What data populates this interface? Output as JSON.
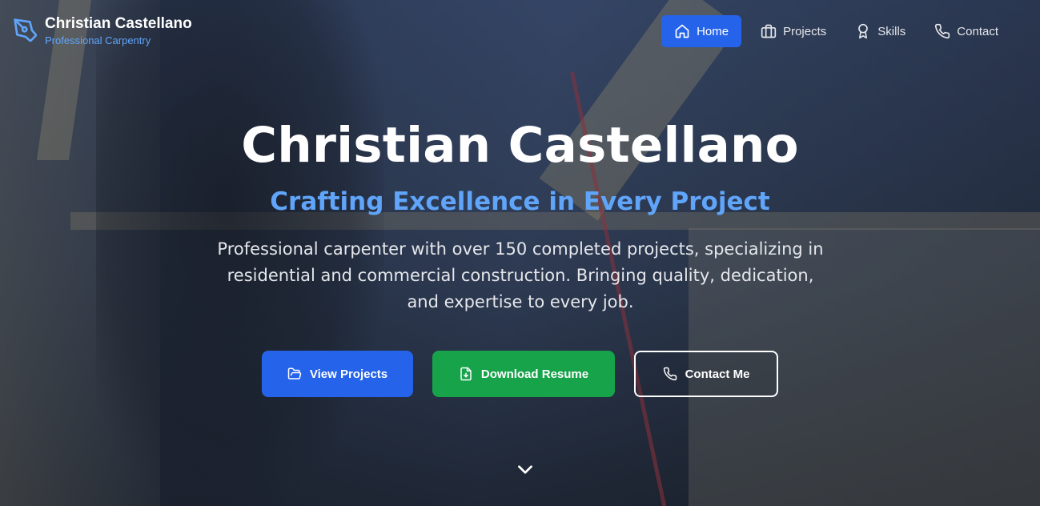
{
  "brand": {
    "name": "Christian Castellano",
    "tagline": "Professional Carpentry",
    "icon": "pen-tool-icon"
  },
  "nav": {
    "items": [
      {
        "label": "Home",
        "icon": "home-icon",
        "active": true
      },
      {
        "label": "Projects",
        "icon": "briefcase-icon",
        "active": false
      },
      {
        "label": "Skills",
        "icon": "award-icon",
        "active": false
      },
      {
        "label": "Contact",
        "icon": "phone-icon",
        "active": false
      }
    ]
  },
  "hero": {
    "title": "Christian Castellano",
    "subtitle": "Crafting Excellence in Every Project",
    "description_lines": [
      "Professional carpenter with over 150 completed projects, specializing in",
      "residential and commercial construction. Bringing quality, dedication,",
      "and expertise to every job."
    ],
    "buttons": {
      "projects": "View Projects",
      "resume": "Download Resume",
      "contact": "Contact Me"
    },
    "scroll_icon": "chevron-down-icon"
  },
  "colors": {
    "accent": "#2563eb",
    "accent_text": "#60a5fa",
    "success": "#16a34a"
  }
}
